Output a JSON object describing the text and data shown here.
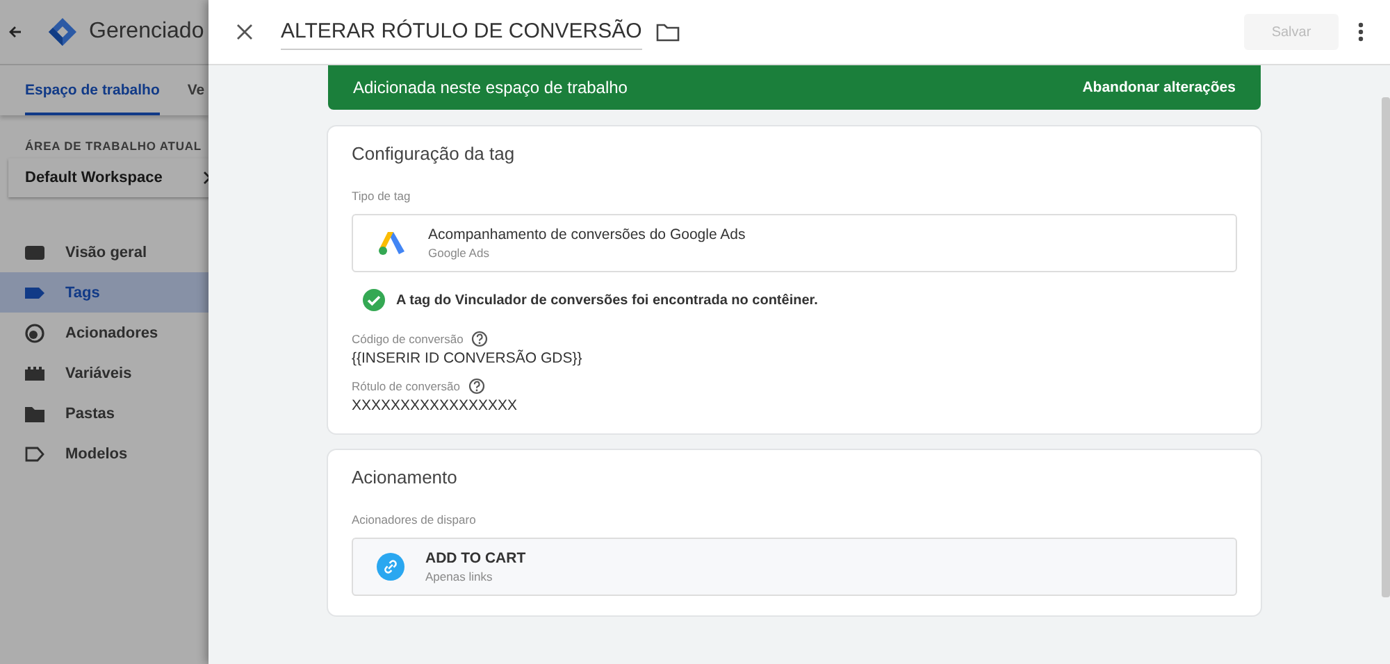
{
  "background_page": {
    "app_title": "Gerenciado",
    "tabs": [
      {
        "label": "Espaço de trabalho",
        "selected": true
      },
      {
        "label": "Ve",
        "selected": false
      }
    ],
    "workspace_label": "ÁREA DE TRABALHO ATUAL",
    "workspace": "Default Workspace",
    "nav": [
      {
        "label": "Visão geral",
        "kind": "overview",
        "selected": false
      },
      {
        "label": "Tags",
        "kind": "tag",
        "selected": true
      },
      {
        "label": "Acionadores",
        "kind": "trigger",
        "selected": false
      },
      {
        "label": "Variáveis",
        "kind": "variable",
        "selected": false
      },
      {
        "label": "Pastas",
        "kind": "folder",
        "selected": false
      },
      {
        "label": "Modelos",
        "kind": "template",
        "selected": false
      }
    ]
  },
  "panel": {
    "title": "ALTERAR RÓTULO DE CONVERSÃO",
    "save_button": {
      "label": "Salvar",
      "disabled": true
    },
    "banner": {
      "text": "Adicionada neste espaço de trabalho",
      "action": "Abandonar alterações"
    },
    "tag_config": {
      "title": "Configuração da tag",
      "type_label": "Tipo de tag",
      "tag_type": {
        "name": "Acompanhamento de conversões do Google Ads",
        "vendor": "Google Ads"
      },
      "notice": "A tag do Vinculador de conversões foi encontrada no contêiner.",
      "fields": [
        {
          "label": "Código de conversão",
          "value": "{{INSERIR ID CONVERSÃO GDS}}"
        },
        {
          "label": "Rótulo de conversão",
          "value": "XXXXXXXXXXXXXXXXX"
        }
      ]
    },
    "triggering": {
      "title": "Acionamento",
      "label": "Acionadores de disparo",
      "triggers": [
        {
          "name": "ADD TO CART",
          "type": "Apenas links"
        }
      ]
    }
  }
}
